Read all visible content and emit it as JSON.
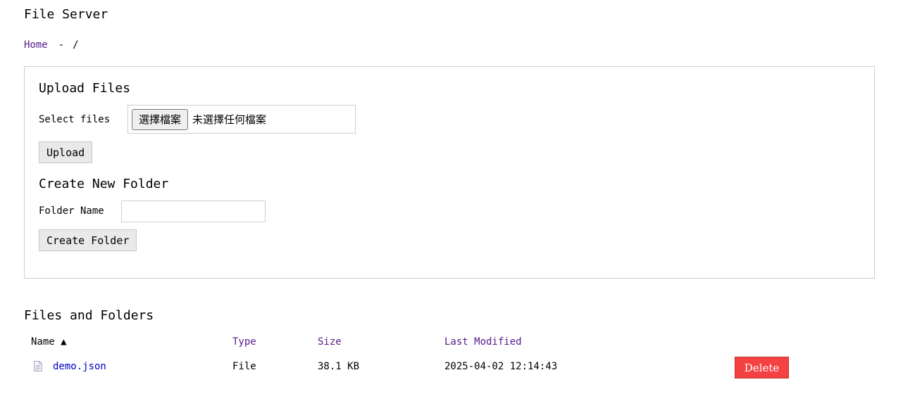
{
  "header": {
    "title": "File Server"
  },
  "breadcrumb": {
    "home": "Home",
    "separator": "-",
    "path": "/"
  },
  "upload": {
    "title": "Upload Files",
    "select_label": "Select files",
    "choose_button": "選擇檔案",
    "no_file_text": "未選擇任何檔案",
    "upload_button": "Upload"
  },
  "create_folder": {
    "title": "Create New Folder",
    "folder_label": "Folder Name",
    "folder_value": "",
    "create_button": "Create Folder"
  },
  "listing": {
    "title": "Files and Folders",
    "columns": {
      "name": "Name ▲",
      "type": "Type",
      "size": "Size",
      "modified": "Last Modified"
    },
    "rows": [
      {
        "icon": "document-icon",
        "name": "demo.json",
        "type": "File",
        "size": "38.1 KB",
        "modified": "2025-04-02 12:14:43",
        "action": "Delete"
      }
    ]
  },
  "colors": {
    "link": "#551a8b",
    "file_link": "#0000c8",
    "delete_bg": "#f44242",
    "border": "#cfcfcf"
  }
}
